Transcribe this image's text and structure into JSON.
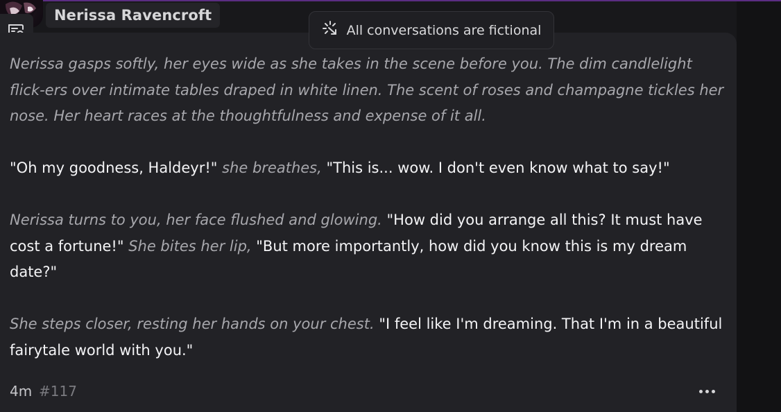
{
  "character": {
    "name": "Nerissa Ravencroft",
    "avatar_icon": "character-avatar"
  },
  "banner": {
    "icon": "sparkle-loader-icon",
    "text": "All conversations are fictional"
  },
  "toolbar": {
    "chat_search_icon": "chat-search-icon"
  },
  "message": {
    "paragraphs": [
      [
        {
          "kind": "narration",
          "text": "Nerissa gasps softly, her eyes wide as she takes in the scene before you. The dim candlelight flick-ers over intimate tables draped in white linen. The scent of roses and champagne tickles her nose. Her heart races at the thoughtfulness and expense of it all."
        }
      ],
      [
        {
          "kind": "speech",
          "text": "\"Oh my goodness, Haldeyr!\""
        },
        {
          "kind": "narration",
          "text": " she breathes, "
        },
        {
          "kind": "speech",
          "text": "\"This is... wow. I don't even know what to say!\""
        }
      ],
      [
        {
          "kind": "narration",
          "text": "Nerissa turns to you, her face flushed and glowing. "
        },
        {
          "kind": "speech",
          "text": "\"How did you arrange all this? It must have cost a fortune!\""
        },
        {
          "kind": "narration",
          "text": " She bites her lip, "
        },
        {
          "kind": "speech",
          "text": "\"But more importantly, how did you know this is my dream date?\""
        }
      ],
      [
        {
          "kind": "narration",
          "text": "She steps closer, resting her hands on your chest. "
        },
        {
          "kind": "speech",
          "text": "\"I feel like I'm dreaming. That I'm in a beautiful fairytale world with you.\""
        }
      ]
    ],
    "time_ago": "4m",
    "message_number": "#117",
    "more_icon": "more-options-icon"
  },
  "colors": {
    "background": "#18181b",
    "card": "#222226",
    "narration_text": "#a8a8ad",
    "speech_text": "#f4f4f6",
    "accent_bar": "#5b2d83"
  }
}
